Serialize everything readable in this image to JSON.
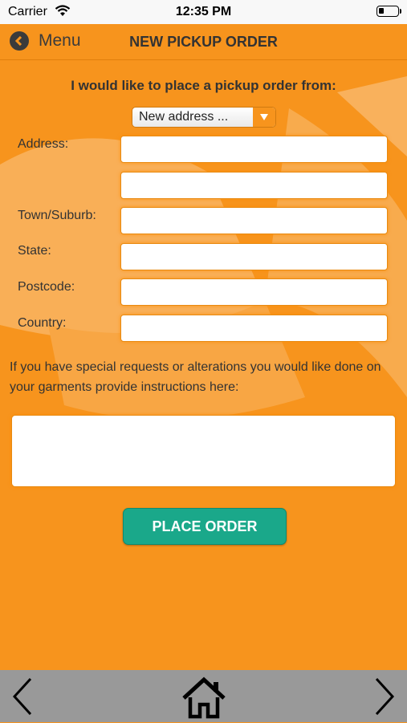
{
  "status_bar": {
    "carrier": "Carrier",
    "time": "12:35 PM",
    "wifi_icon": "wifi-icon",
    "battery_icon": "battery-icon"
  },
  "navbar": {
    "back_label": "Menu",
    "back_icon": "back-arrow-circle-icon",
    "title": "NEW PICKUP ORDER"
  },
  "form": {
    "heading": "I would like to place a pickup order from:",
    "address_select": {
      "value": "New address ...",
      "arrow_icon": "dropdown-arrow-icon"
    },
    "labels": {
      "address": "Address:",
      "town": "Town/Suburb:",
      "state": "State:",
      "postcode": "Postcode:",
      "country": "Country:"
    },
    "fields": {
      "address_line1": "",
      "address_line2": "",
      "town": "",
      "state": "",
      "postcode": "",
      "country": ""
    },
    "instructions_note": "If you have special requests or alterations you would like done on your garments provide instructions here:",
    "instructions_value": "",
    "submit_label": "PLACE ORDER"
  },
  "tab_bar": {
    "prev_icon": "chevron-left-icon",
    "home_icon": "home-icon",
    "next_icon": "chevron-right-icon"
  },
  "colors": {
    "accent": "#f7941d",
    "button": "#1aa88a",
    "tabbar": "#999999"
  }
}
